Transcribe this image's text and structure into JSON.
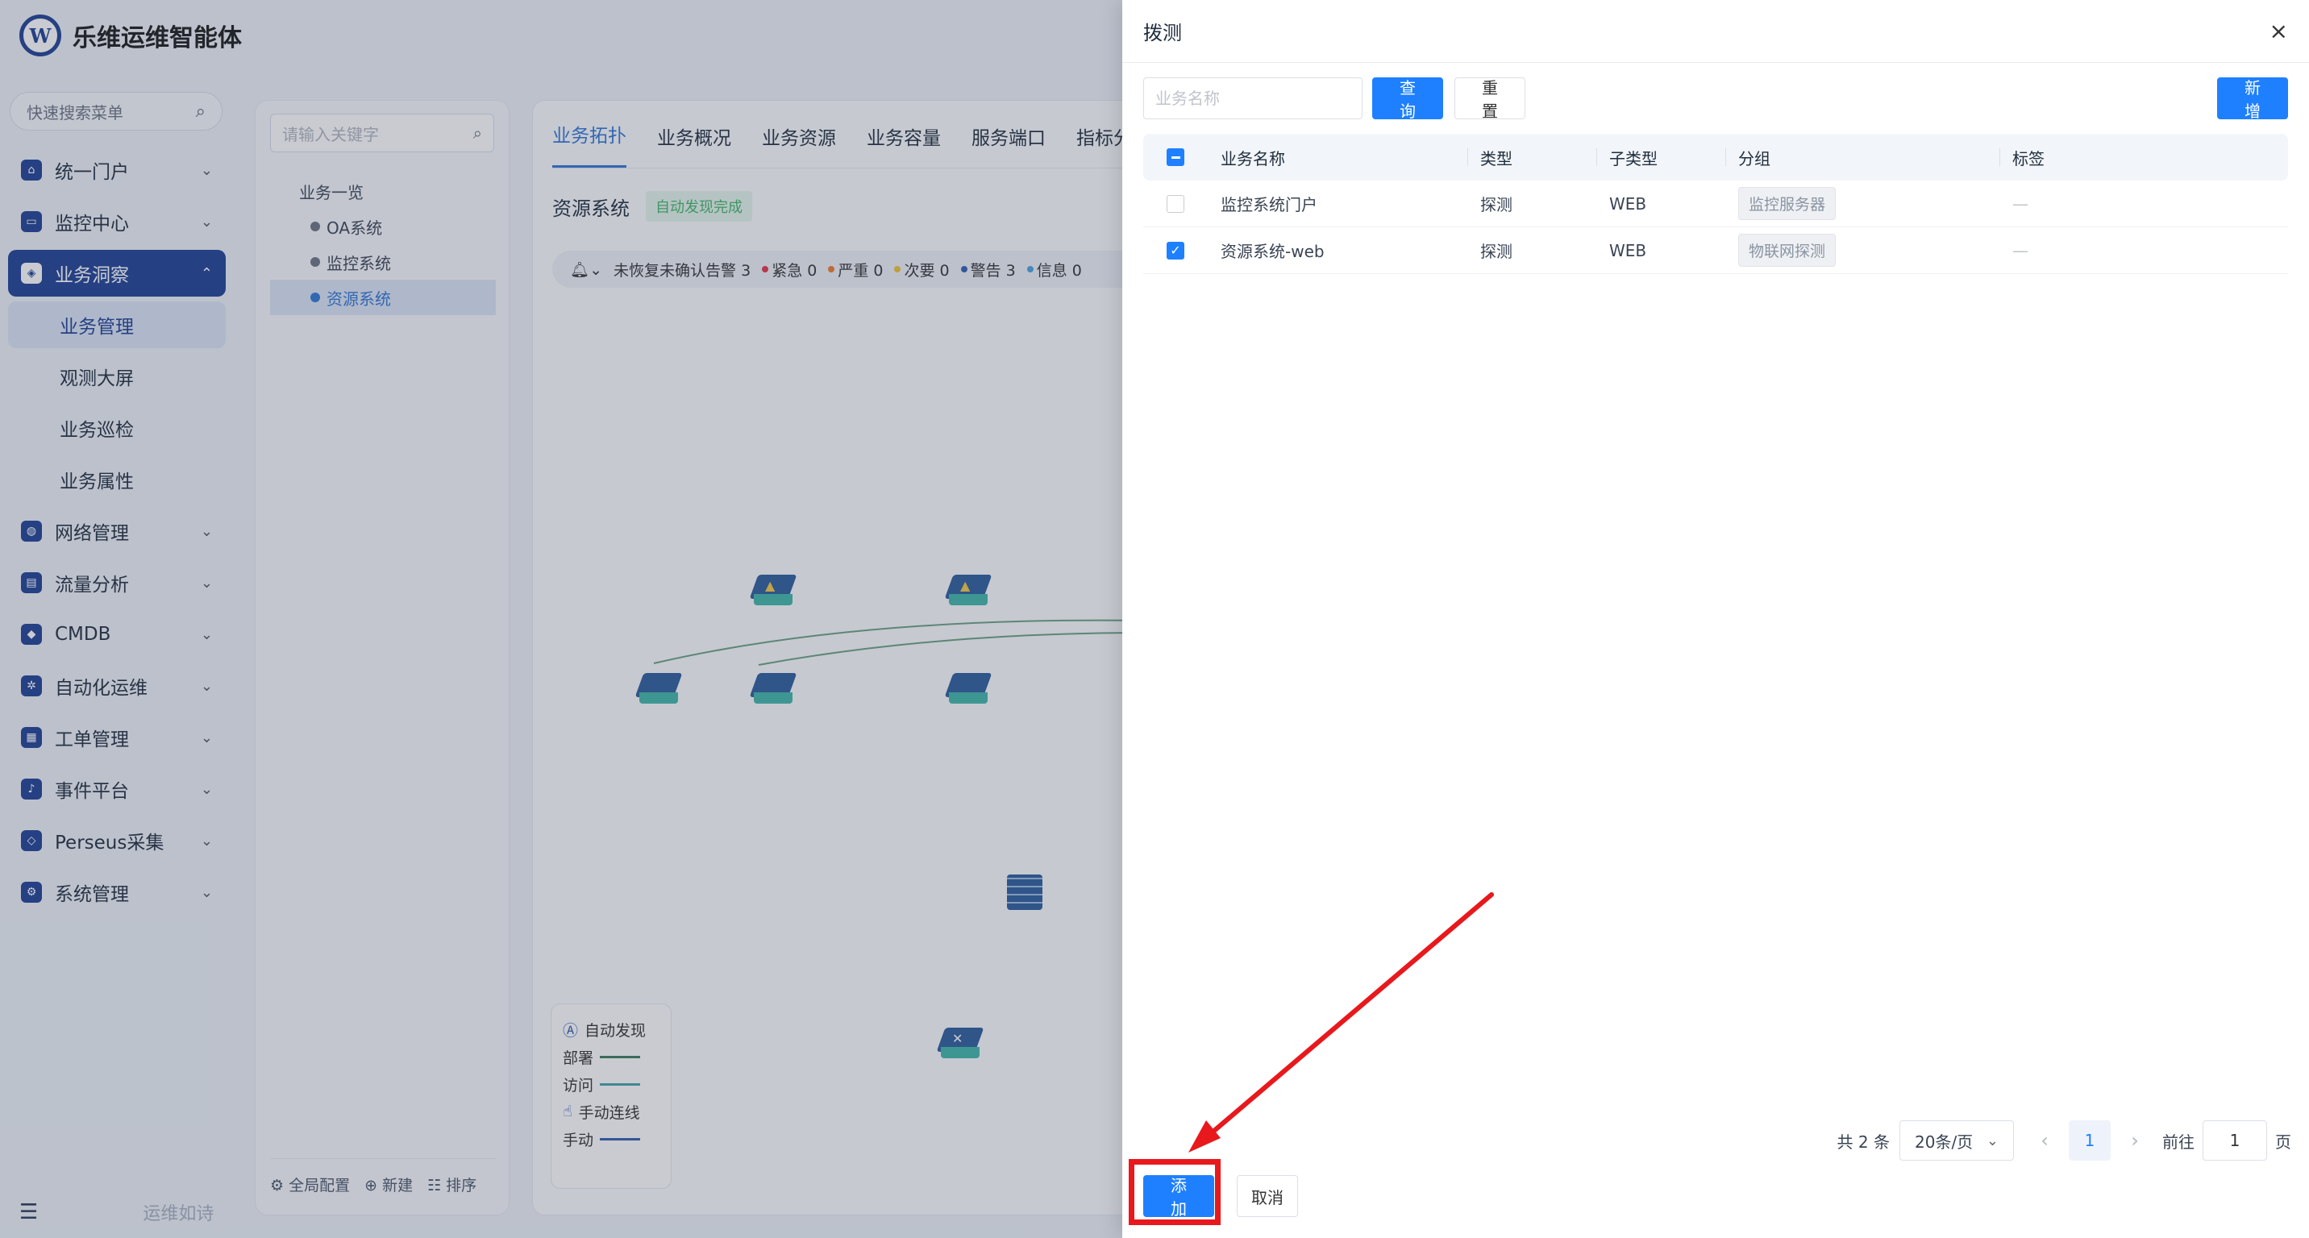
{
  "app": {
    "title": "乐维运维智能体",
    "logo_text": "W"
  },
  "sidebar": {
    "quick_search_placeholder": "快速搜索菜单",
    "menu": [
      {
        "label": "统一门户",
        "icon": "home-icon"
      },
      {
        "label": "监控中心",
        "icon": "monitor-icon"
      },
      {
        "label": "业务洞察",
        "icon": "insight-icon",
        "active": true
      }
    ],
    "sub_menu": [
      {
        "label": "业务管理",
        "active": true
      },
      {
        "label": "观测大屏"
      },
      {
        "label": "业务巡检"
      },
      {
        "label": "业务属性"
      }
    ],
    "menu_after": [
      {
        "label": "网络管理",
        "icon": "globe-icon"
      },
      {
        "label": "流量分析",
        "icon": "chart-icon"
      },
      {
        "label": "CMDB",
        "icon": "cube-icon"
      },
      {
        "label": "自动化运维",
        "icon": "gear-icon"
      },
      {
        "label": "工单管理",
        "icon": "calendar-icon"
      },
      {
        "label": "事件平台",
        "icon": "bell-icon"
      },
      {
        "label": "Perseus采集",
        "icon": "diamond-icon"
      },
      {
        "label": "系统管理",
        "icon": "settings-icon"
      }
    ],
    "bottom_text": "运维如诗"
  },
  "tree": {
    "search_placeholder": "请输入关键字",
    "root": "业务一览",
    "children": [
      "OA系统",
      "监控系统",
      "资源系统"
    ],
    "footer": [
      "全局配置",
      "新建",
      "排序"
    ]
  },
  "main": {
    "tabs": [
      "业务拓扑",
      "业务概况",
      "业务资源",
      "业务容量",
      "服务端口",
      "指标分"
    ],
    "system_title": "资源系统",
    "system_badge": "自动发现完成",
    "alarm_text": "未恢复未确认告警 3",
    "severities": [
      {
        "label": "紧急 0",
        "color": "#e8344a"
      },
      {
        "label": "严重 0",
        "color": "#f07a2a"
      },
      {
        "label": "次要 0",
        "color": "#f2c230"
      },
      {
        "label": "警告 3",
        "color": "#2f5fb0"
      },
      {
        "label": "信息 0",
        "color": "#4aa3df"
      }
    ],
    "legend": {
      "auto_discover": "自动发现",
      "deploy": "部署",
      "visit": "访问",
      "manual_link": "手动连线",
      "manual": "手动"
    }
  },
  "drawer": {
    "title": "拨测",
    "search_placeholder": "业务名称",
    "query_label": "查询",
    "reset_label": "重置",
    "new_label": "新增",
    "columns": [
      "业务名称",
      "类型",
      "子类型",
      "分组",
      "标签"
    ],
    "rows": [
      {
        "name": "监控系统门户",
        "type": "探测",
        "subtype": "WEB",
        "group": "监控服务器",
        "tag": "—",
        "checked": false
      },
      {
        "name": "资源系统-web",
        "type": "探测",
        "subtype": "WEB",
        "group": "物联网探测",
        "tag": "—",
        "checked": true
      }
    ],
    "pagination": {
      "total": "共 2 条",
      "page_size": "20条/页",
      "current_page": "1",
      "goto_label": "前往",
      "goto_value": "1",
      "page_suffix": "页"
    },
    "add_label": "添加",
    "cancel_label": "取消"
  },
  "colors": {
    "primary": "#1e80ff",
    "brand": "#1c3f94",
    "annotation": "#e8181c"
  }
}
